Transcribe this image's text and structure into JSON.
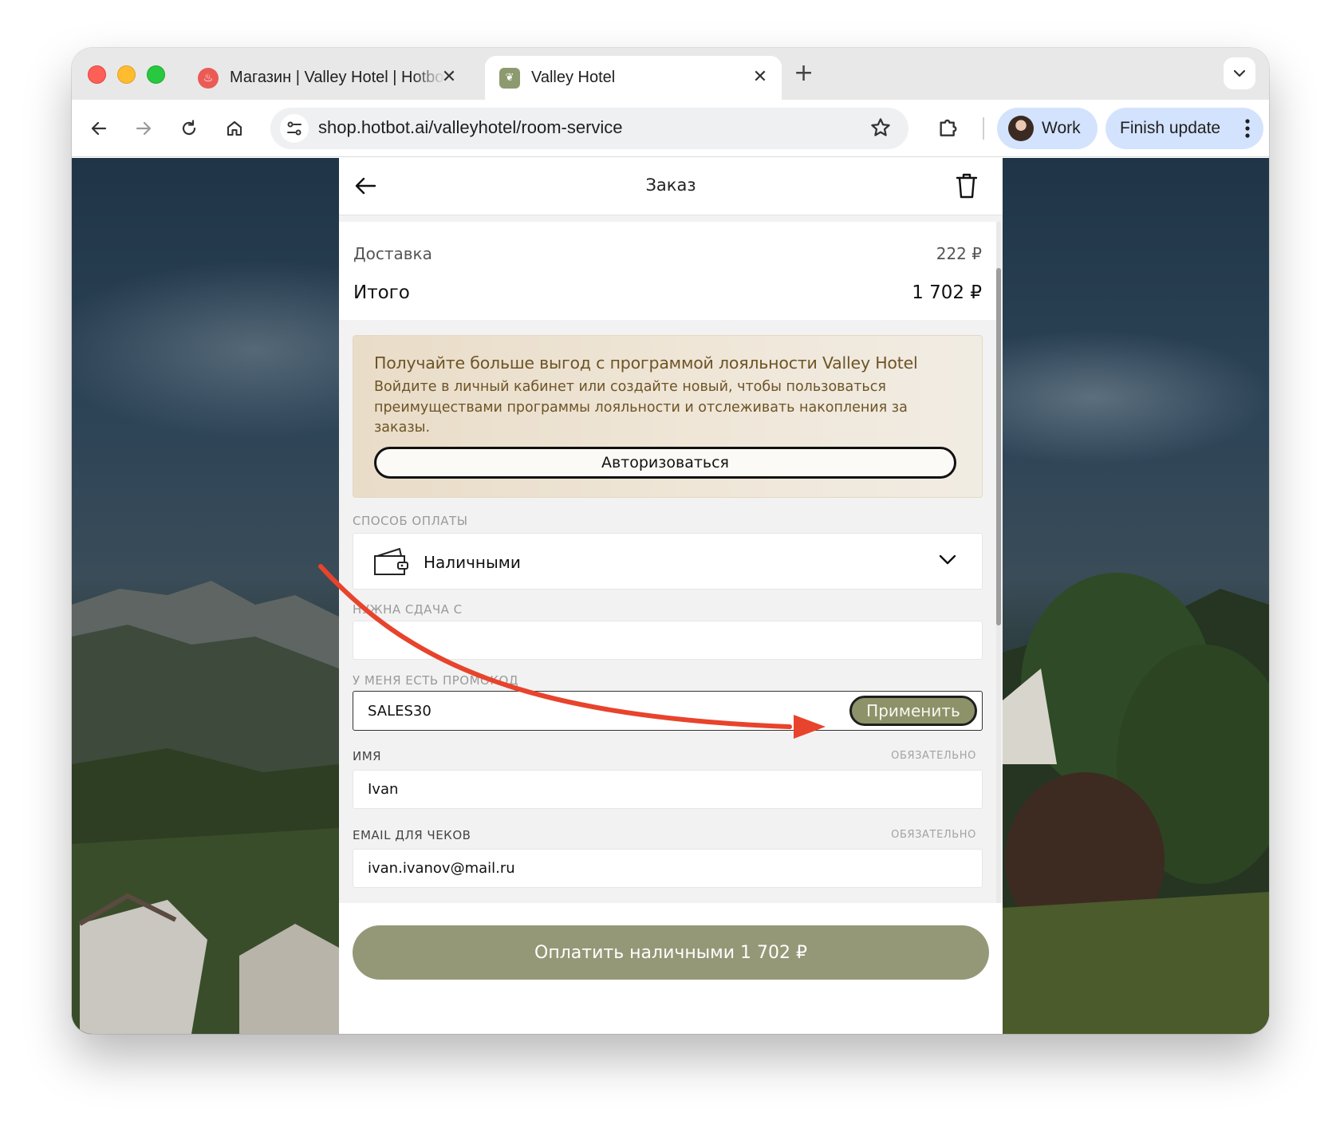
{
  "browser": {
    "tabs": [
      {
        "title": "Магазин | Valley Hotel | Hotbot",
        "close": "✕",
        "favicon": "hotbot-flame-icon"
      },
      {
        "title": "Valley Hotel",
        "close": "✕",
        "favicon": "valley-hotel-icon"
      }
    ],
    "new_tab": "+",
    "url": "shop.hotbot.ai/valleyhotel/room-service",
    "profile_label": "Work",
    "update_label": "Finish update"
  },
  "order": {
    "title": "Заказ",
    "delivery_label": "Доставка",
    "delivery_value": "222 ₽",
    "total_label": "Итого",
    "total_value": "1 702 ₽"
  },
  "loyalty": {
    "title": "Получайте больше выгод с программой лояльности Valley Hotel",
    "text": "Войдите в личный кабинет или создайте новый, чтобы пользоваться преимуществами программы лояльности и отслеживать накопления за заказы.",
    "button": "Авторизоваться"
  },
  "form": {
    "payment_label": "СПОСОБ ОПЛАТЫ",
    "payment_value": "Наличными",
    "change_label": "НУЖНА СДАЧА С",
    "change_value": "",
    "promo_label": "У МЕНЯ ЕСТЬ ПРОМОКОД",
    "promo_value": "SALES30",
    "apply_button": "Применить",
    "name_label": "ИМЯ",
    "name_required": "ОБЯЗАТЕЛЬНО",
    "name_value": "Ivan",
    "email_label": "EMAIL ДЛЯ ЧЕКОВ",
    "email_required": "ОБЯЗАТЕЛЬНО",
    "email_value": "ivan.ivanov@mail.ru"
  },
  "pay_button": "Оплатить наличными 1 702 ₽",
  "colors": {
    "accent_olive": "#959877",
    "apply_olive": "#8d9269",
    "loyalty_text": "#6d5426",
    "annotation_arrow": "#e8432c"
  }
}
